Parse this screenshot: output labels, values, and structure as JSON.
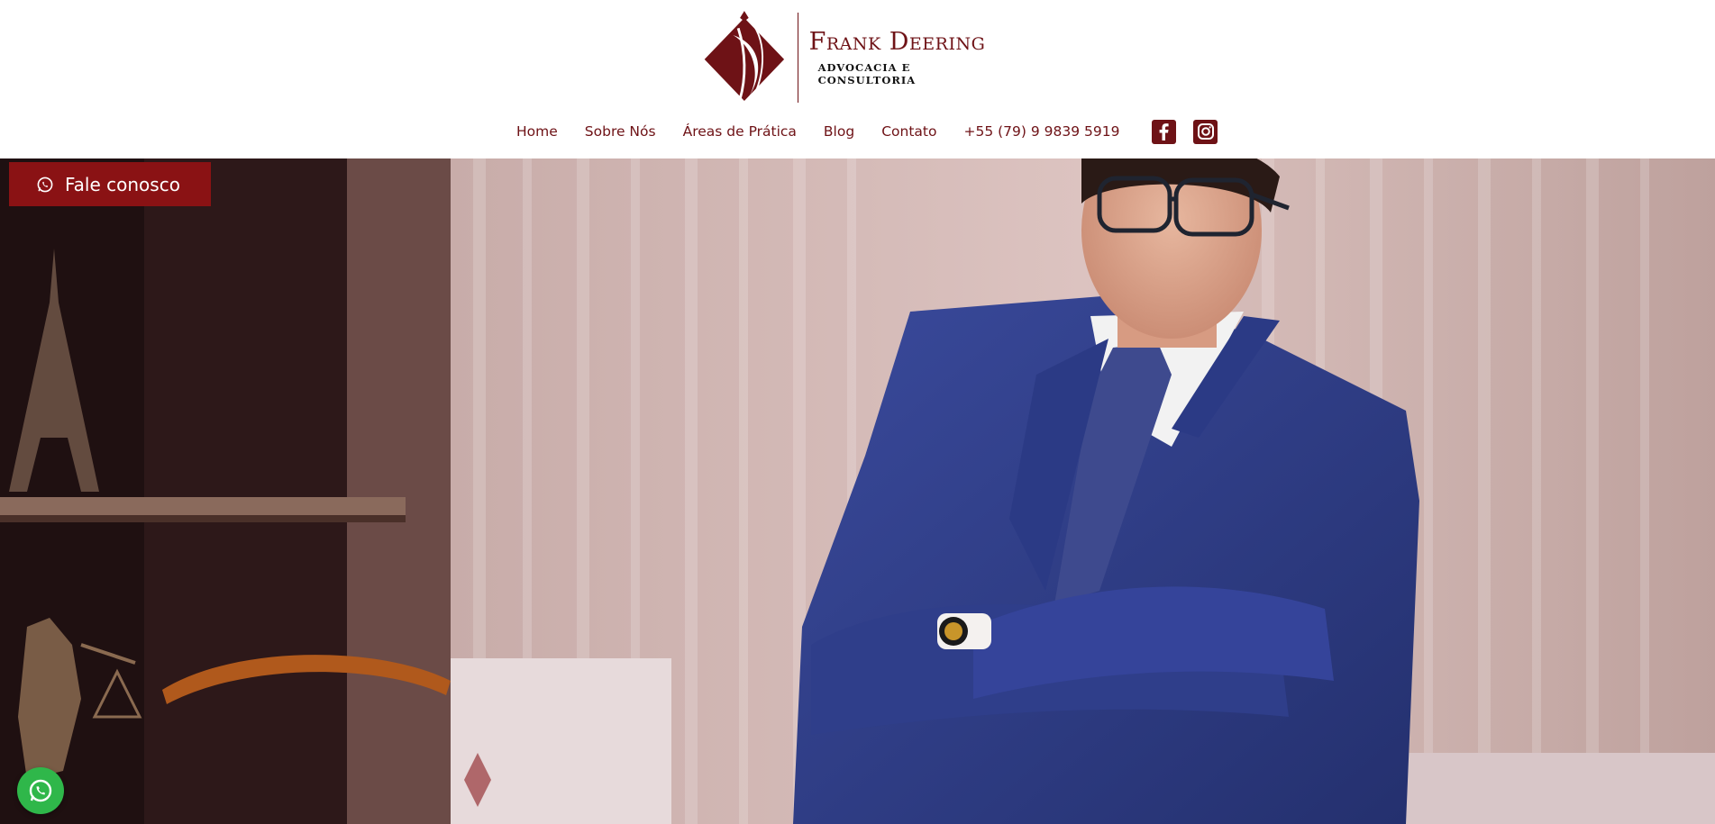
{
  "brand": {
    "name": "Frank Deering",
    "tagline": "ADVOCACIA E CONSULTORIA",
    "color": "#6e1216"
  },
  "nav": {
    "items": [
      "Home",
      "Sobre Nós",
      "Áreas de Prática",
      "Blog",
      "Contato"
    ],
    "phone": "+55 (79) 9 9839 5919",
    "social": [
      "facebook-icon",
      "instagram-icon"
    ]
  },
  "hero": {
    "cta_label": "Fale conosco",
    "cta_color": "#8a1214",
    "whatsapp_color": "#2fb74a"
  }
}
